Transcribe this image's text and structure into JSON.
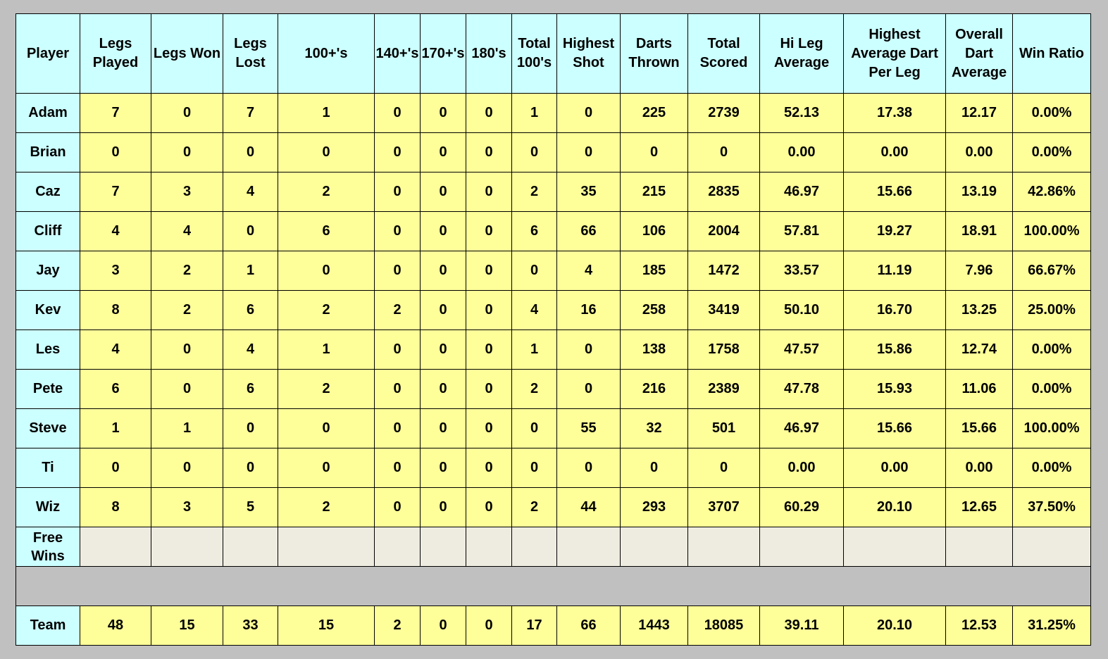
{
  "colors": {
    "header_bg": "#ccffff",
    "value_bg": "#ffff99",
    "free_wins_bg": "#eeece1",
    "free_wins_text": "#ff0000",
    "gap_bg": "#c0c0c0"
  },
  "table": {
    "headers": [
      "Player",
      "Legs Played",
      "Legs Won",
      "Legs Lost",
      "100+'s",
      "140+'s",
      "170+'s",
      "180's",
      "Total 100's",
      "Highest Shot",
      "Darts Thrown",
      "Total Scored",
      "Hi Leg Average",
      "Highest Average Dart Per Leg",
      "Overall Dart Average",
      "Win Ratio"
    ],
    "rows": [
      [
        "Adam",
        "7",
        "0",
        "7",
        "1",
        "0",
        "0",
        "0",
        "1",
        "0",
        "225",
        "2739",
        "52.13",
        "17.38",
        "12.17",
        "0.00%"
      ],
      [
        "Brian",
        "0",
        "0",
        "0",
        "0",
        "0",
        "0",
        "0",
        "0",
        "0",
        "0",
        "0",
        "0.00",
        "0.00",
        "0.00",
        "0.00%"
      ],
      [
        "Caz",
        "7",
        "3",
        "4",
        "2",
        "0",
        "0",
        "0",
        "2",
        "35",
        "215",
        "2835",
        "46.97",
        "15.66",
        "13.19",
        "42.86%"
      ],
      [
        "Cliff",
        "4",
        "4",
        "0",
        "6",
        "0",
        "0",
        "0",
        "6",
        "66",
        "106",
        "2004",
        "57.81",
        "19.27",
        "18.91",
        "100.00%"
      ],
      [
        "Jay",
        "3",
        "2",
        "1",
        "0",
        "0",
        "0",
        "0",
        "0",
        "4",
        "185",
        "1472",
        "33.57",
        "11.19",
        "7.96",
        "66.67%"
      ],
      [
        "Kev",
        "8",
        "2",
        "6",
        "2",
        "2",
        "0",
        "0",
        "4",
        "16",
        "258",
        "3419",
        "50.10",
        "16.70",
        "13.25",
        "25.00%"
      ],
      [
        "Les",
        "4",
        "0",
        "4",
        "1",
        "0",
        "0",
        "0",
        "1",
        "0",
        "138",
        "1758",
        "47.57",
        "15.86",
        "12.74",
        "0.00%"
      ],
      [
        "Pete",
        "6",
        "0",
        "6",
        "2",
        "0",
        "0",
        "0",
        "2",
        "0",
        "216",
        "2389",
        "47.78",
        "15.93",
        "11.06",
        "0.00%"
      ],
      [
        "Steve",
        "1",
        "1",
        "0",
        "0",
        "0",
        "0",
        "0",
        "0",
        "55",
        "32",
        "501",
        "46.97",
        "15.66",
        "15.66",
        "100.00%"
      ],
      [
        "Ti",
        "0",
        "0",
        "0",
        "0",
        "0",
        "0",
        "0",
        "0",
        "0",
        "0",
        "0",
        "0.00",
        "0.00",
        "0.00",
        "0.00%"
      ],
      [
        "Wiz",
        "8",
        "3",
        "5",
        "2",
        "0",
        "0",
        "0",
        "2",
        "44",
        "293",
        "3707",
        "60.29",
        "20.10",
        "12.65",
        "37.50%"
      ]
    ],
    "free_wins_label": "Free Wins",
    "team": [
      "Team",
      "48",
      "15",
      "33",
      "15",
      "2",
      "0",
      "0",
      "17",
      "66",
      "1443",
      "18085",
      "39.11",
      "20.10",
      "12.53",
      "31.25%"
    ]
  }
}
